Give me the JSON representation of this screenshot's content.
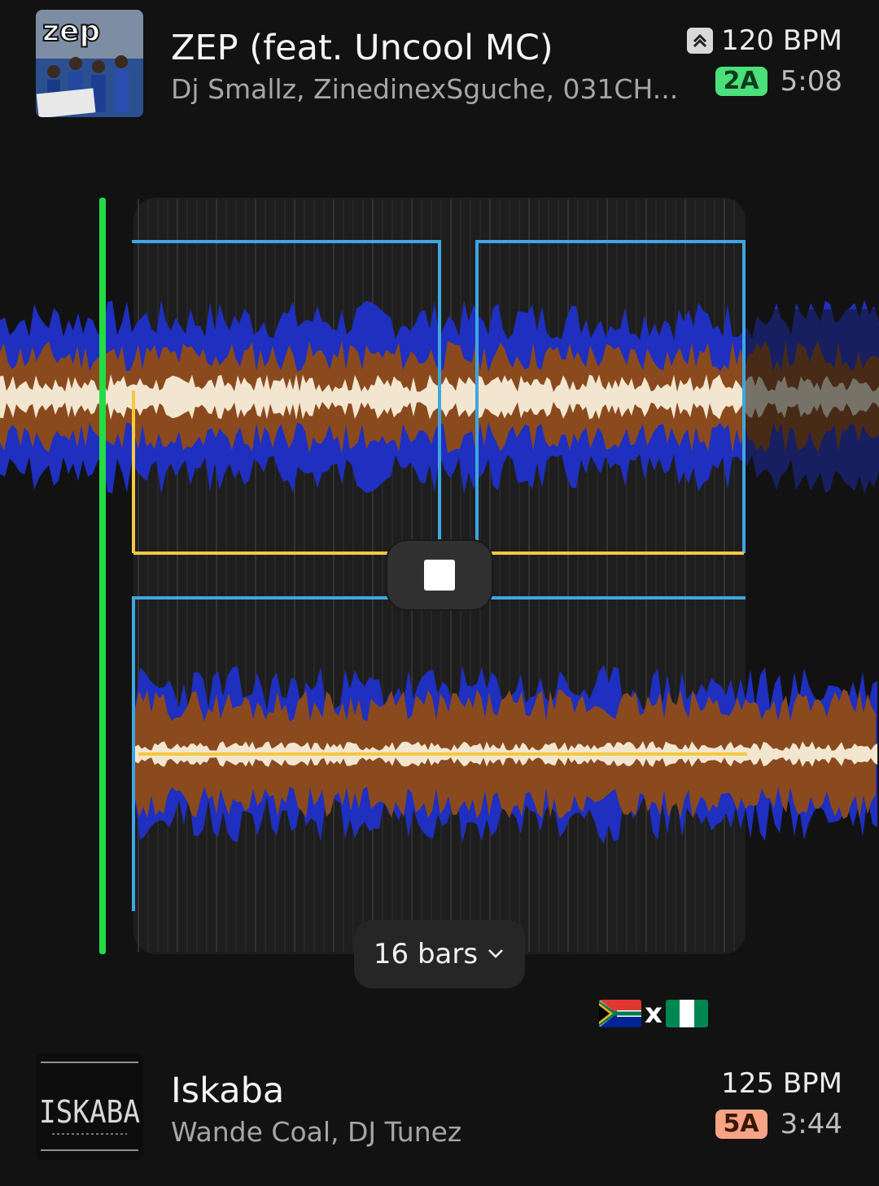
{
  "top_track": {
    "title": "ZEP (feat. Uncool MC)",
    "artists": "Dj Smallz, ZinedinexSguche, 031CH...",
    "bpm": "120 BPM",
    "key": "2A",
    "duration": "5:08",
    "cover_text": "zep",
    "bpm_icon": "double-chevron-up-icon"
  },
  "bottom_track": {
    "title": "Iskaba",
    "artists": "Wande Coal, DJ Tunez",
    "bpm": "125 BPM",
    "key": "5A",
    "duration": "3:44",
    "cover_text": "ISKABA"
  },
  "controls": {
    "loop_length_label": "16 bars",
    "stop_icon": "stop-icon",
    "dropdown_icon": "chevron-down-icon"
  },
  "tag": {
    "text": "x",
    "flags": [
      "south-africa-flag",
      "nigeria-flag"
    ]
  },
  "colors": {
    "background": "#121212",
    "wave_blue": "#1f2fbf",
    "wave_brown": "#8a4a1e",
    "wave_cream": "#f2e6d0",
    "playhead": "#22dd44",
    "loop_blue": "#3ea6e0",
    "loop_yellow": "#f5c842",
    "key_top": "#4be07a",
    "key_bottom": "#f7a486"
  }
}
